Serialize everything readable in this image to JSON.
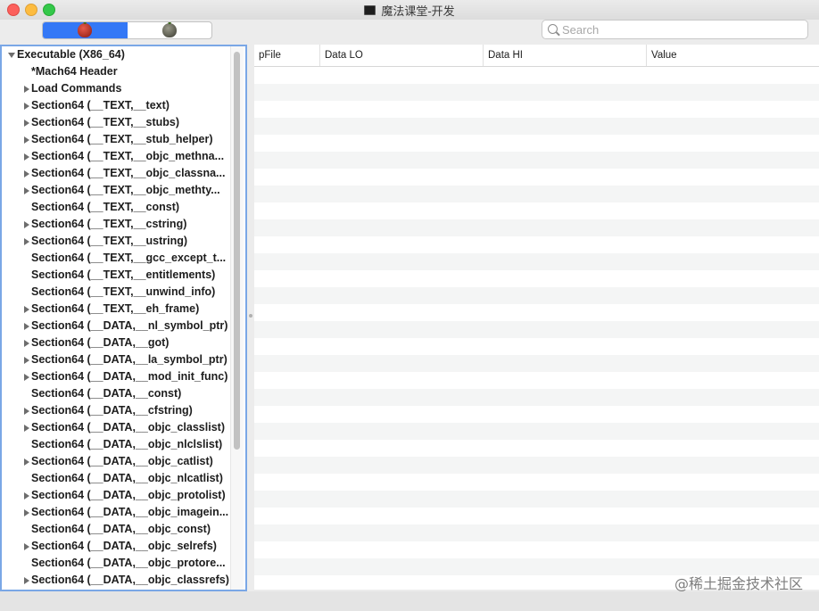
{
  "window": {
    "title": "魔法课堂-开发"
  },
  "toolbar": {
    "segments": [
      {
        "icon": "apple-red-icon",
        "active": true
      },
      {
        "icon": "apple-gray-icon",
        "active": false
      }
    ],
    "search": {
      "placeholder": "Search",
      "value": ""
    }
  },
  "tree": {
    "root": "Executable  (X86_64)",
    "items": [
      {
        "label": "*Mach64 Header",
        "expandable": false
      },
      {
        "label": "Load Commands",
        "expandable": true
      },
      {
        "label": "Section64 (__TEXT,__text)",
        "expandable": true
      },
      {
        "label": "Section64 (__TEXT,__stubs)",
        "expandable": true
      },
      {
        "label": "Section64 (__TEXT,__stub_helper)",
        "expandable": true
      },
      {
        "label": "Section64 (__TEXT,__objc_methna...",
        "expandable": true
      },
      {
        "label": "Section64 (__TEXT,__objc_classna...",
        "expandable": true
      },
      {
        "label": "Section64 (__TEXT,__objc_methty...",
        "expandable": true
      },
      {
        "label": "Section64 (__TEXT,__const)",
        "expandable": false
      },
      {
        "label": "Section64 (__TEXT,__cstring)",
        "expandable": true
      },
      {
        "label": "Section64 (__TEXT,__ustring)",
        "expandable": true
      },
      {
        "label": "Section64 (__TEXT,__gcc_except_t...",
        "expandable": false
      },
      {
        "label": "Section64 (__TEXT,__entitlements)",
        "expandable": false
      },
      {
        "label": "Section64 (__TEXT,__unwind_info)",
        "expandable": false
      },
      {
        "label": "Section64 (__TEXT,__eh_frame)",
        "expandable": true
      },
      {
        "label": "Section64 (__DATA,__nl_symbol_ptr)",
        "expandable": true
      },
      {
        "label": "Section64 (__DATA,__got)",
        "expandable": true
      },
      {
        "label": "Section64 (__DATA,__la_symbol_ptr)",
        "expandable": true
      },
      {
        "label": "Section64 (__DATA,__mod_init_func)",
        "expandable": true
      },
      {
        "label": "Section64 (__DATA,__const)",
        "expandable": false
      },
      {
        "label": "Section64 (__DATA,__cfstring)",
        "expandable": true
      },
      {
        "label": "Section64 (__DATA,__objc_classlist)",
        "expandable": true
      },
      {
        "label": "Section64 (__DATA,__objc_nlclslist)",
        "expandable": false
      },
      {
        "label": "Section64 (__DATA,__objc_catlist)",
        "expandable": true
      },
      {
        "label": "Section64 (__DATA,__objc_nlcatlist)",
        "expandable": false
      },
      {
        "label": "Section64 (__DATA,__objc_protolist)",
        "expandable": true
      },
      {
        "label": "Section64 (__DATA,__objc_imagein...",
        "expandable": true
      },
      {
        "label": "Section64 (__DATA,__objc_const)",
        "expandable": false
      },
      {
        "label": "Section64 (__DATA,__objc_selrefs)",
        "expandable": true
      },
      {
        "label": "Section64 (__DATA,__objc_protore...",
        "expandable": false
      },
      {
        "label": "Section64 (__DATA,__objc_classrefs)",
        "expandable": true
      }
    ]
  },
  "table": {
    "columns": [
      "pFile",
      "Data LO",
      "Data HI",
      "Value"
    ],
    "rows": []
  },
  "watermark": "@稀土掘金技术社区"
}
